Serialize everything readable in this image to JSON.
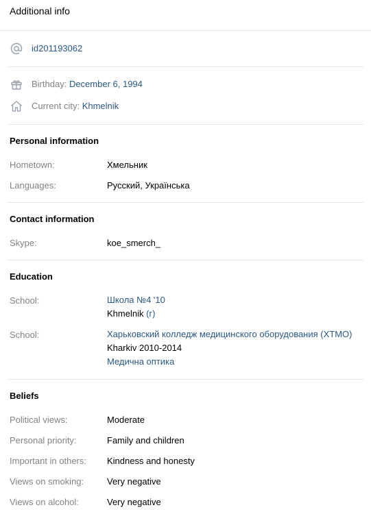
{
  "header": {
    "title": "Additional info"
  },
  "contacts": {
    "id_link": "id201193062",
    "birthday_label": "Birthday:",
    "birthday_value": "December 6, 1994",
    "city_label": "Current city:",
    "city_value": "Khmelnik"
  },
  "personal": {
    "title": "Personal information",
    "rows": [
      {
        "label": "Hometown:",
        "value": "Хмельник"
      },
      {
        "label": "Languages:",
        "value": "Русский, Українська"
      }
    ]
  },
  "contact_info": {
    "title": "Contact information",
    "skype_label": "Skype:",
    "skype_value": "koe_smerch_"
  },
  "education": {
    "title": "Education",
    "schools": [
      {
        "label": "School:",
        "name": "Школа №4 '10",
        "city": "Khmelnik",
        "city_suffix": "(г)"
      },
      {
        "label": "School:",
        "name": "Харьковский колледж медицинского оборудования (ХТМО)",
        "detail": "Kharkiv 2010-2014",
        "specialty": "Медична оптика"
      }
    ]
  },
  "beliefs": {
    "title": "Beliefs",
    "rows": [
      {
        "label": "Political views:",
        "value": "Moderate"
      },
      {
        "label": "Personal priority:",
        "value": "Family and children"
      },
      {
        "label": "Important in others:",
        "value": "Kindness and honesty"
      },
      {
        "label": "Views on smoking:",
        "value": "Very negative"
      },
      {
        "label": "Views on alcohol:",
        "value": "Very negative"
      }
    ]
  },
  "colors": {
    "link": "#2a5885",
    "label": "#828282",
    "divider": "#e7e8ec",
    "icon": "#99a2ad"
  }
}
